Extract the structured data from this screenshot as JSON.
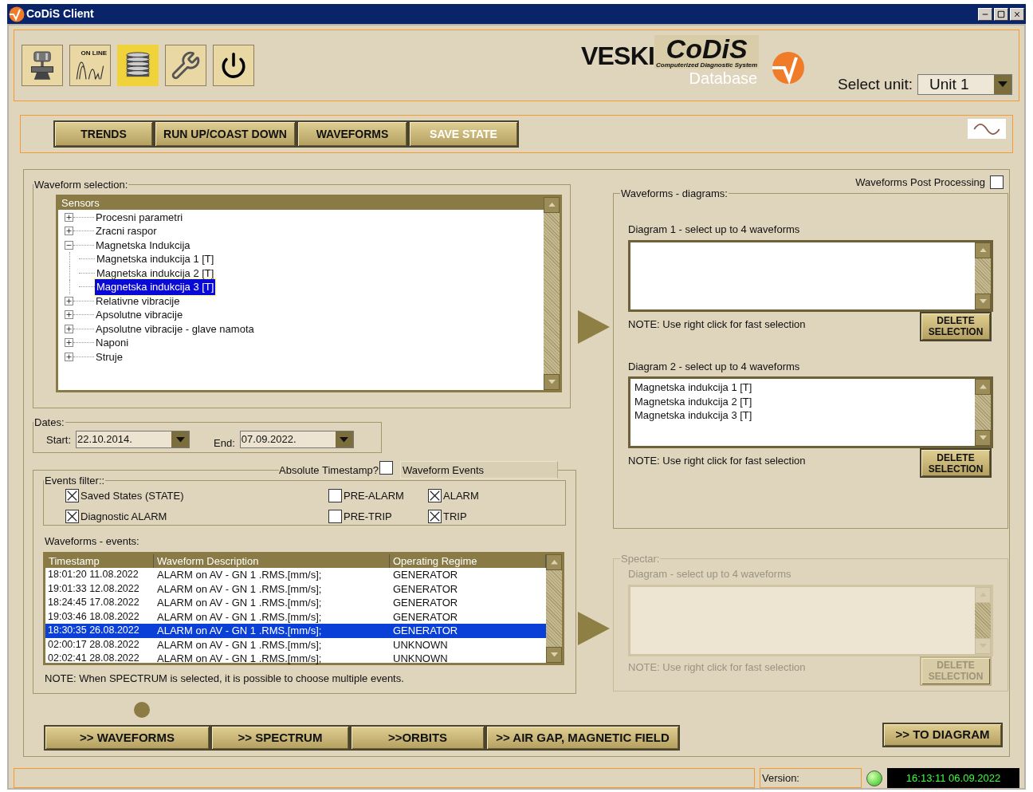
{
  "window": {
    "title": "CoDiS Client"
  },
  "toolbar": {
    "tools": [
      {
        "kind": "machine",
        "selected": false
      },
      {
        "kind": "online",
        "label": "ON LINE",
        "selected": false
      },
      {
        "kind": "database",
        "selected": true
      },
      {
        "kind": "wrench",
        "selected": false
      },
      {
        "kind": "power",
        "selected": false
      }
    ]
  },
  "logo": {
    "brand": "VESKI",
    "product": "CoDiS",
    "tagline": "Computerized Diagnostic System",
    "module": "Database"
  },
  "unit_select": {
    "label": "Select unit:",
    "value": "Unit 1"
  },
  "nav_buttons": [
    {
      "label": "TRENDS",
      "highlighted": false
    },
    {
      "label": "RUN UP/COAST DOWN",
      "highlighted": false
    },
    {
      "label": "WAVEFORMS",
      "highlighted": false
    },
    {
      "label": "SAVE STATE",
      "highlighted": true
    }
  ],
  "waveform_selection": {
    "title": "Waveform selection:",
    "tree_header": "Sensors",
    "tree": [
      {
        "label": "Procesni parametri",
        "expanded": false,
        "selected": false
      },
      {
        "label": "Zracni raspor",
        "expanded": false,
        "selected": false
      },
      {
        "label": "Magnetska Indukcija",
        "expanded": true,
        "selected": false,
        "children": [
          {
            "label": "Magnetska indukcija 1 [T]",
            "selected": false
          },
          {
            "label": "Magnetska indukcija 2 [T]",
            "selected": false
          },
          {
            "label": "Magnetska indukcija 3 [T]",
            "selected": true
          }
        ]
      },
      {
        "label": "Relativne vibracije",
        "expanded": false,
        "selected": false
      },
      {
        "label": "Apsolutne vibracije",
        "expanded": false,
        "selected": false
      },
      {
        "label": "Apsolutne vibracije - glave namota",
        "expanded": false,
        "selected": false
      },
      {
        "label": "Naponi",
        "expanded": false,
        "selected": false
      },
      {
        "label": "Struje",
        "expanded": false,
        "selected": false
      }
    ]
  },
  "dates": {
    "title": "Dates:",
    "start_label": "Start:",
    "start": "22.10.2014.",
    "end_label": "End:",
    "end": "07.09.2022."
  },
  "absolute_timestamp": {
    "label": "Absolute Timestamp?",
    "checked": false
  },
  "events_tab": "Waveform Events",
  "events_filter": {
    "title": "Events filter::",
    "options": [
      {
        "label": "Saved States (STATE)",
        "checked": true
      },
      {
        "label": "PRE-ALARM",
        "checked": false
      },
      {
        "label": "ALARM",
        "checked": true
      },
      {
        "label": "Diagnostic ALARM",
        "checked": true
      },
      {
        "label": "PRE-TRIP",
        "checked": false
      },
      {
        "label": "TRIP",
        "checked": true
      }
    ]
  },
  "events": {
    "title": "Waveforms - events:",
    "columns": [
      "Timestamp",
      "Waveform Description",
      "Operating Regime"
    ],
    "rows": [
      {
        "cells": [
          "18:01:20  11.08.2022",
          "ALARM on AV - GN 1 .RMS.[mm/s];",
          "GENERATOR"
        ],
        "selected": false
      },
      {
        "cells": [
          "19:01:33  12.08.2022",
          "ALARM on AV - GN 1 .RMS.[mm/s];",
          "GENERATOR"
        ],
        "selected": false
      },
      {
        "cells": [
          "18:24:45  17.08.2022",
          "ALARM on AV - GN 1 .RMS.[mm/s];",
          "GENERATOR"
        ],
        "selected": false
      },
      {
        "cells": [
          "19:03:46  18.08.2022",
          "ALARM on AV - GN 1 .RMS.[mm/s];",
          "GENERATOR"
        ],
        "selected": false
      },
      {
        "cells": [
          "18:30:35  26.08.2022",
          "ALARM on AV - GN 1 .RMS.[mm/s];",
          "GENERATOR"
        ],
        "selected": true
      },
      {
        "cells": [
          "02:00:17  28.08.2022",
          "ALARM on AV - GN 1 .RMS.[mm/s];",
          "UNKNOWN"
        ],
        "selected": false
      },
      {
        "cells": [
          "02:02:41  28.08.2022",
          "ALARM on AV - GN 1 .RMS.[mm/s];",
          "UNKNOWN"
        ],
        "selected": false
      }
    ],
    "note": "NOTE:  When SPECTRUM is selected, it is possible to choose multiple events."
  },
  "post_processing": {
    "label": "Waveforms Post Processing",
    "checked": false
  },
  "diagrams": {
    "title": "Waveforms - diagrams:",
    "items": [
      {
        "label": "Diagram 1 - select up to 4 waveforms",
        "note": "NOTE: Use right click for fast selection",
        "button": "DELETE SELECTION"
      },
      {
        "label": "Diagram 2 - select up to 4 waveforms",
        "entries": [
          "Magnetska indukcija 1 [T]",
          "Magnetska indukcija 2 [T]",
          "Magnetska indukcija 3 [T]"
        ],
        "note": "NOTE: Use right click for fast selection",
        "button": "DELETE SELECTION"
      }
    ]
  },
  "spectar": {
    "title": "Spectar:",
    "disabled": true,
    "label": "Diagram - select up to 4 waveforms",
    "note": "NOTE: Use right click for fast selection",
    "button": "DELETE SELECTION"
  },
  "action_buttons": [
    ">> WAVEFORMS",
    ">> SPECTRUM",
    ">>ORBITS",
    ">> AIR GAP, MAGNETIC FIELD"
  ],
  "to_diagram": ">> TO DIAGRAM",
  "status_bar": {
    "version_label": "Version:",
    "connected": true,
    "clock": "16:13:11 06.09.2022"
  }
}
